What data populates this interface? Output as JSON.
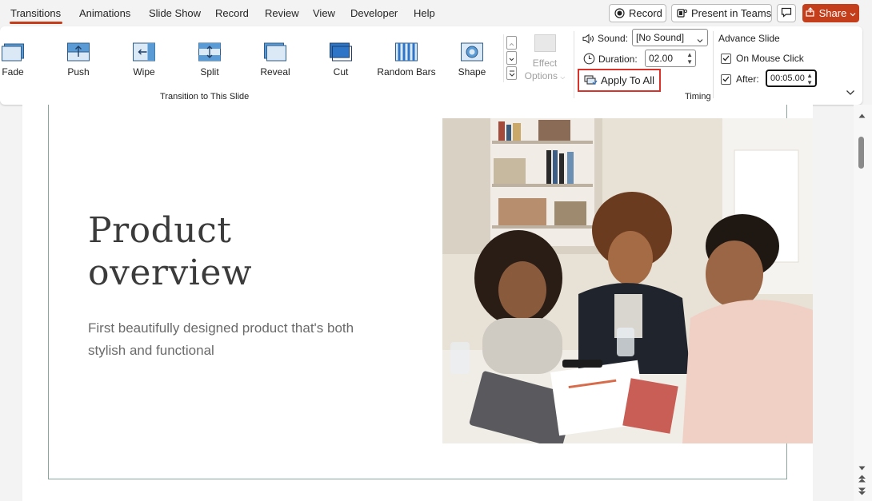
{
  "menu": {
    "tabs": [
      "Transitions",
      "Animations",
      "Slide Show",
      "Record",
      "Review",
      "View",
      "Developer",
      "Help"
    ],
    "record_label": "Record",
    "present_label": "Present in Teams",
    "share_label": "Share"
  },
  "ribbon": {
    "transitions": [
      "Fade",
      "Push",
      "Wipe",
      "Split",
      "Reveal",
      "Cut",
      "Random Bars",
      "Shape"
    ],
    "effect_options_line1": "Effect",
    "effect_options_line2": "Options",
    "group_transition_label": "Transition to This Slide",
    "group_timing_label": "Timing",
    "sound_label": "Sound:",
    "sound_value": "[No Sound]",
    "duration_label": "Duration:",
    "duration_value": "02.00",
    "apply_all_label": "Apply To All",
    "advance_label": "Advance Slide",
    "on_mouse_click_label": "On Mouse Click",
    "after_label": "After:",
    "after_value": "00:05.00"
  },
  "slide": {
    "title_line1": "Product",
    "title_line2": "overview",
    "subtitle": "First beautifully designed product that's both stylish and functional"
  },
  "colors": {
    "accent": "#c43e1c",
    "highlight": "#d9322a"
  }
}
